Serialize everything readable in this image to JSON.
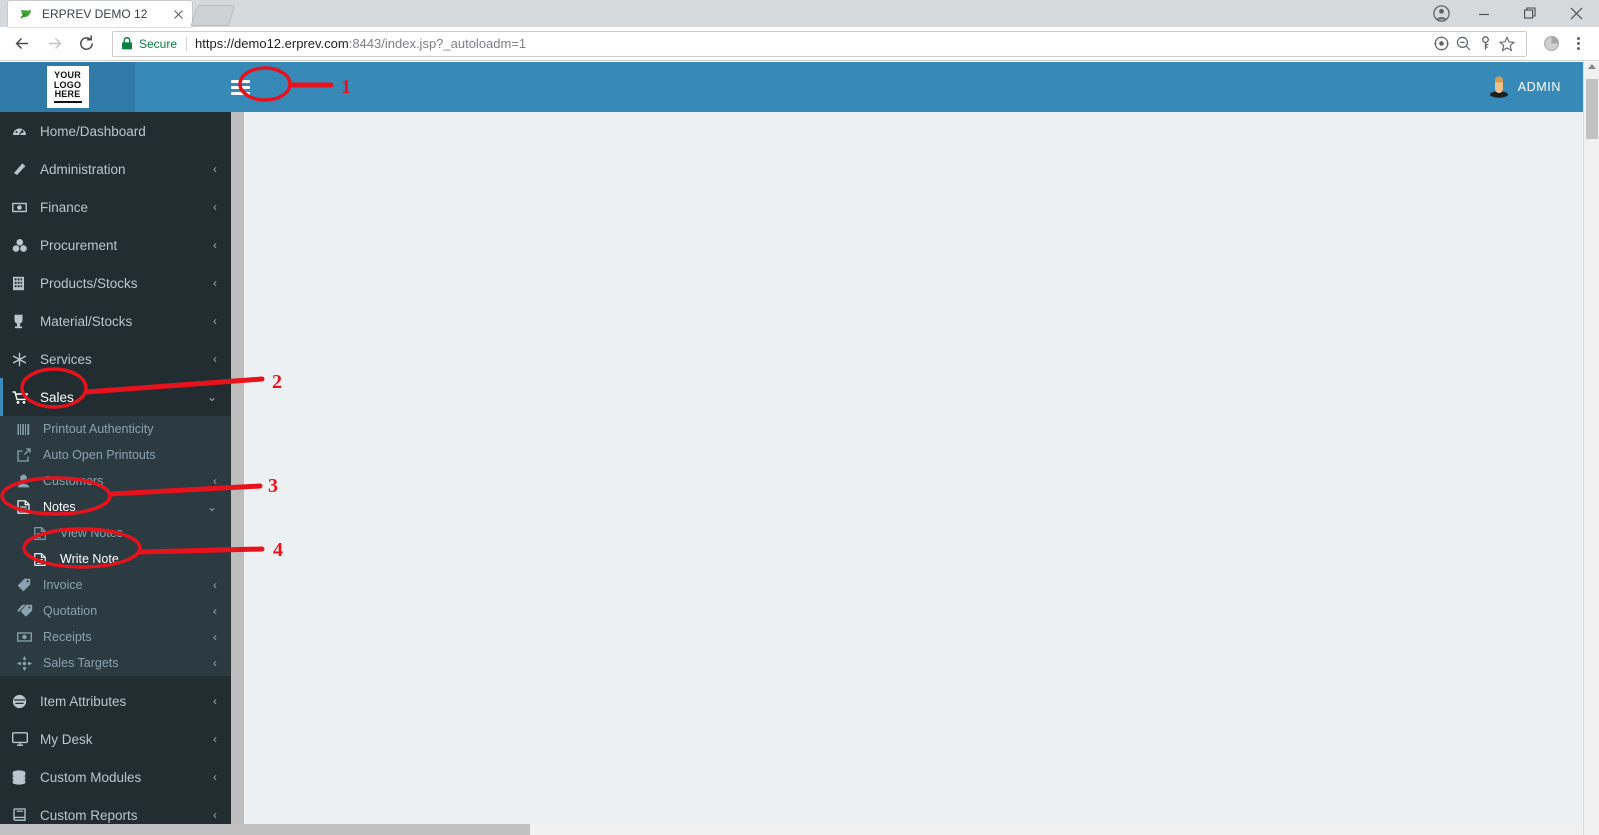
{
  "browser": {
    "tab": {
      "title": "ERPREV DEMO 12",
      "favicon": "erprev-leaf-icon",
      "close": "✕"
    },
    "new_tab": "new-tab-button",
    "window_controls": {
      "profile": "profile-icon",
      "minimize": "—",
      "maximize": "❐",
      "close": "✕"
    },
    "nav": {
      "back": "←",
      "forward": "→",
      "reload": "↻"
    },
    "omnibox": {
      "security_label": "Secure",
      "url_prefix": "https://demo12.erprev.com",
      "url_port": ":8443",
      "url_path": "/index.jsp?_autoloadm=1",
      "full_url": "https://demo12.erprev.com:8443/index.jsp?_autoloadm=1",
      "icons": [
        "cast-icon",
        "zoom-out-icon",
        "key-icon",
        "bookmark-star-icon"
      ]
    },
    "extension_icon": "extension-icon",
    "menu": "three-dot-menu"
  },
  "app": {
    "logo": {
      "line1": "YOUR",
      "line2": "LOGO",
      "line3": "HERE"
    },
    "menu_toggle": "hamburger-menu-icon",
    "user": {
      "name": "ADMIN",
      "avatar": "user-avatar-icon"
    },
    "colors": {
      "header_blue": "#3789b8",
      "logo_blue": "#2f7aa6",
      "sidebar_dark": "#222d32",
      "submenu": "#2c3b41",
      "accent": "#3c8dbc",
      "content_bg": "#ecf0f3",
      "annotation_red": "#e8121d"
    }
  },
  "sidebar": {
    "items": [
      {
        "label": "Home/Dashboard",
        "icon": "dashboard-icon",
        "chevron": "",
        "state": "normal"
      },
      {
        "label": "Administration",
        "icon": "tools-icon",
        "chevron": "‹",
        "state": "normal"
      },
      {
        "label": "Finance",
        "icon": "money-icon",
        "chevron": "‹",
        "state": "normal"
      },
      {
        "label": "Procurement",
        "icon": "procurement-icon",
        "chevron": "‹",
        "state": "normal"
      },
      {
        "label": "Products/Stocks",
        "icon": "building-icon",
        "chevron": "‹",
        "state": "normal"
      },
      {
        "label": "Material/Stocks",
        "icon": "trophy-icon",
        "chevron": "‹",
        "state": "normal"
      },
      {
        "label": "Services",
        "icon": "snowflake-icon",
        "chevron": "‹",
        "state": "normal"
      },
      {
        "label": "Sales",
        "icon": "cart-icon",
        "chevron": "⌄",
        "state": "active"
      }
    ],
    "sales_submenu": [
      {
        "label": "Printout Authenticity",
        "icon": "barcode-icon",
        "chevron": ""
      },
      {
        "label": "Auto Open Printouts",
        "icon": "external-link-icon",
        "chevron": ""
      },
      {
        "label": "Customers",
        "icon": "user-icon",
        "chevron": "‹"
      },
      {
        "label": "Notes",
        "icon": "note-icon",
        "chevron": "⌄",
        "state": "open"
      }
    ],
    "notes_submenu": [
      {
        "label": "View Notes",
        "icon": "note-icon",
        "state": "normal"
      },
      {
        "label": "Write Note",
        "icon": "note-icon",
        "state": "current"
      }
    ],
    "sales_submenu_rest": [
      {
        "label": "Invoice",
        "icon": "tag-icon",
        "chevron": "‹"
      },
      {
        "label": "Quotation",
        "icon": "tags-icon",
        "chevron": "‹"
      },
      {
        "label": "Receipts",
        "icon": "money-icon",
        "chevron": "‹"
      },
      {
        "label": "Sales Targets",
        "icon": "crosshair-icon",
        "chevron": "‹"
      }
    ],
    "items_after": [
      {
        "label": "Item Attributes",
        "icon": "circle-lines-icon",
        "chevron": "‹"
      },
      {
        "label": "My Desk",
        "icon": "monitor-icon",
        "chevron": "‹"
      },
      {
        "label": "Custom Modules",
        "icon": "database-icon",
        "chevron": "‹"
      },
      {
        "label": "Custom Reports",
        "icon": "book-icon",
        "chevron": "‹"
      }
    ]
  },
  "annotations": {
    "markers": [
      {
        "number": "1",
        "target": "hamburger-menu-icon"
      },
      {
        "number": "2",
        "target": "sidebar-item-sales"
      },
      {
        "number": "3",
        "target": "sidebar-item-notes"
      },
      {
        "number": "4",
        "target": "sidebar-item-write-note"
      }
    ]
  }
}
